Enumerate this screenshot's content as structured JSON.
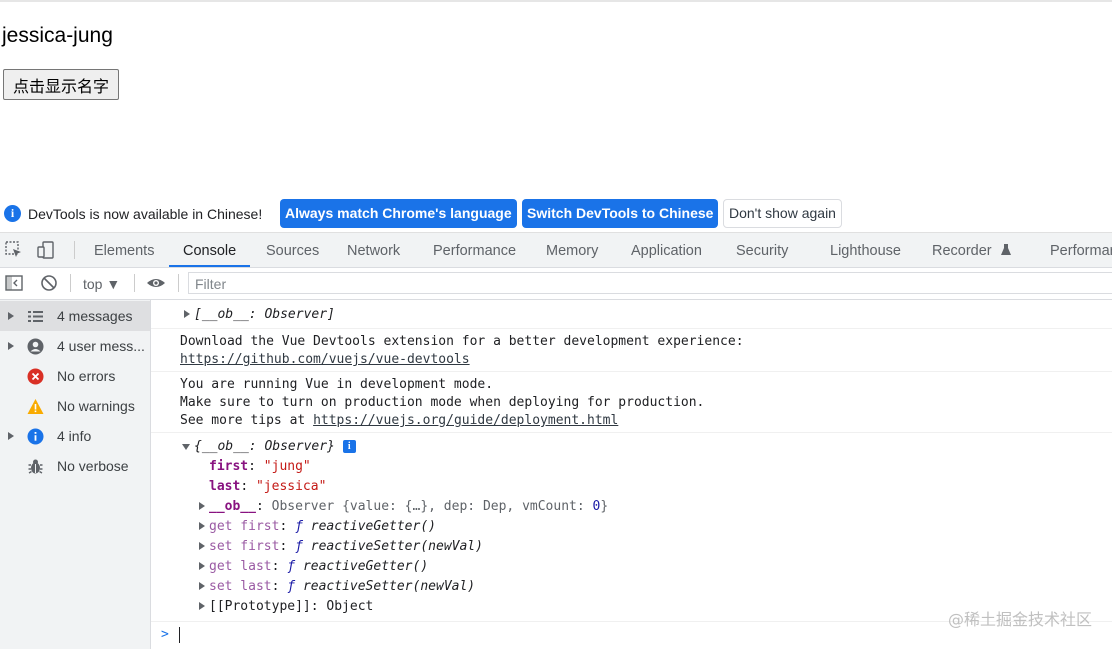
{
  "page": {
    "name": "jessica-jung",
    "button_label": "点击显示名字"
  },
  "infobar": {
    "text": "DevTools is now available in Chinese!",
    "btn_match": "Always match Chrome's language",
    "btn_switch": "Switch DevTools to Chinese",
    "btn_dont_show": "Don't show again"
  },
  "tabs": [
    "Elements",
    "Console",
    "Sources",
    "Network",
    "Performance",
    "Memory",
    "Application",
    "Security",
    "Lighthouse",
    "Recorder",
    "Performar"
  ],
  "filterbar": {
    "context": "top ▼",
    "filter_placeholder": "Filter"
  },
  "sidebar": [
    {
      "label": "4 messages",
      "icon": "list-icon"
    },
    {
      "label": "4 user mess...",
      "icon": "user-icon"
    },
    {
      "label": "No errors",
      "icon": "error-icon"
    },
    {
      "label": "No warnings",
      "icon": "warning-icon"
    },
    {
      "label": "4 info",
      "icon": "info-icon"
    },
    {
      "label": "No verbose",
      "icon": "bug-icon"
    }
  ],
  "console": {
    "line0": "[__ob__: Observer]",
    "vue_devtools_msg": "Download the Vue Devtools extension for a better development experience:",
    "vue_devtools_link": "https://github.com/vuejs/vue-devtools",
    "dev_mode_1": "You are running Vue in development mode.",
    "dev_mode_2": "Make sure to turn on production mode when deploying for production.",
    "dev_mode_3_prefix": "See more tips at ",
    "dev_mode_3_link": "https://vuejs.org/guide/deployment.html",
    "obj_header": "{__ob__: Observer}",
    "badge": "i",
    "first_key": "first",
    "first_val": "\"jung\"",
    "last_key": "last",
    "last_val": "\"jessica\"",
    "ob_key": "__ob__",
    "ob_val_pre": "Observer {value: {…}, dep: Dep, vmCount: ",
    "ob_val_num": "0",
    "ob_val_post": "}",
    "get_first": "get first",
    "set_first": "set first",
    "get_last": "get last",
    "set_last": "set last",
    "fn_mark": "ƒ",
    "getter": "reactiveGetter()",
    "setter": "reactiveSetter(newVal)",
    "proto": "[[Prototype]]: Object"
  },
  "watermark": "@稀土掘金技术社区"
}
